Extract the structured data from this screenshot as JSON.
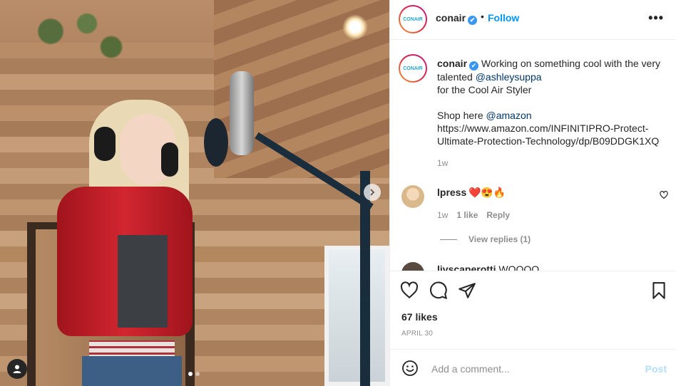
{
  "header": {
    "avatar_text": "CONAIR",
    "username": "conair",
    "verified_mark": "✔",
    "separator": "•",
    "follow_label": "Follow",
    "more_label": "•••"
  },
  "caption": {
    "avatar_text": "CONAIR",
    "username": "conair",
    "verified_mark": "✔",
    "text1": " Working on something cool with the very talented ",
    "mention": "@ashleysuppa",
    "text2": "for the Cool Air Styler",
    "shop_text": "Shop here ",
    "shop_mention": "@amazon",
    "url": "https://www.amazon.com/INFINITIPRO-Protect-Ultimate-Protection-Technology/dp/B09DDGK1XQ",
    "time": "1w"
  },
  "comments": [
    {
      "username": "lpress",
      "text": "❤️😍🔥",
      "time": "1w",
      "likes": "1 like",
      "reply_label": "Reply",
      "view_replies": "View replies (1)"
    },
    {
      "username": "livscaperotti",
      "text": "WOOOO"
    }
  ],
  "actions": {
    "likes": "67 likes",
    "date": "APRIL 30"
  },
  "comment_box": {
    "placeholder": "Add a comment...",
    "post_label": "Post"
  },
  "colors": {
    "follow": "#0095f6",
    "post_disabled": "#b2dffc",
    "verified": "#3897f0"
  },
  "icons": [
    "heart-icon",
    "comment-icon",
    "share-icon",
    "bookmark-icon",
    "emoji-icon",
    "user-tag-icon",
    "next-arrow-icon",
    "more-icon"
  ]
}
